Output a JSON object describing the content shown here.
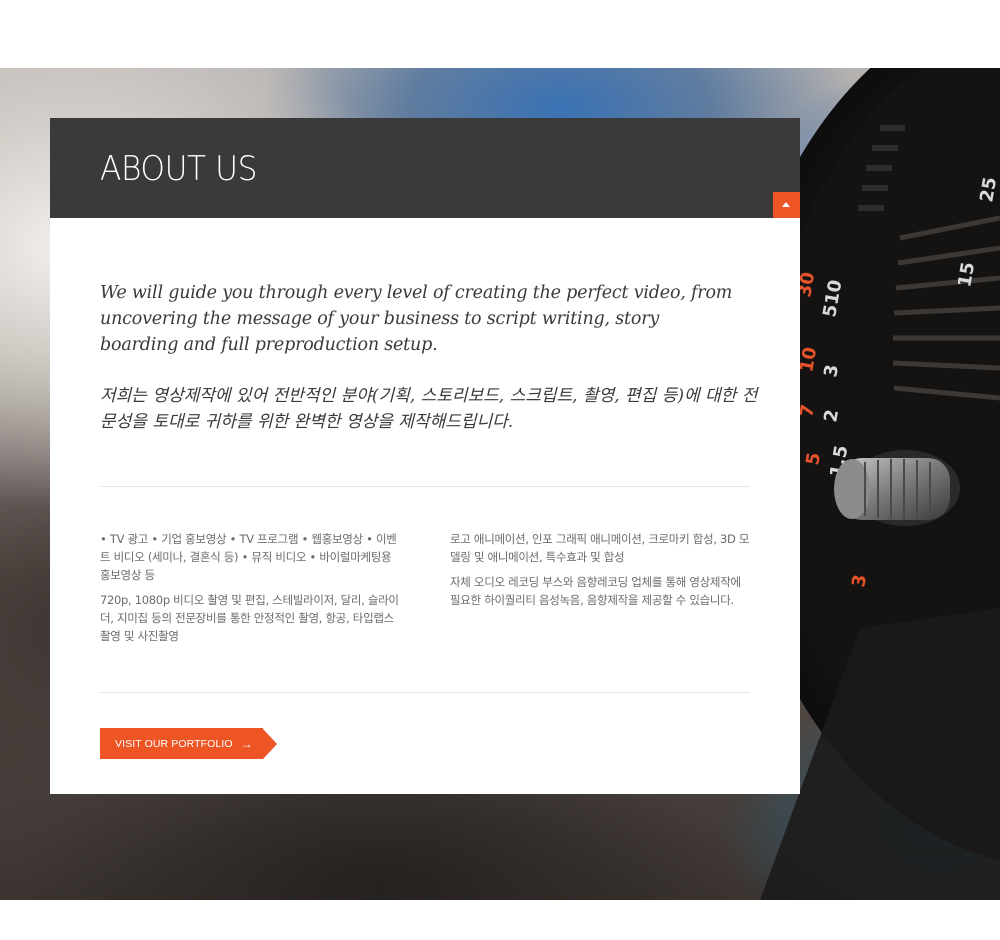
{
  "about": {
    "title": "ABOUT US",
    "intro_en": "We will guide you through every level of creating the perfect video, from uncovering the message of your business to script writing, story boarding and full preproduction setup.",
    "intro_ko": "저희는 영상제작에 있어 전반적인 분야(기획, 스토리보드, 스크립트, 촬영, 편집 등)에 대한 전문성을 토대로 귀하를 위한 완벽한 영상을 제작해드립니다.",
    "services_left": [
      "• TV 광고 • 기업 홍보영상 • TV 프로그램 • 웹홍보영상 • 이벤트 비디오 (세미나, 결혼식 등) • 뮤직 비디오 • 바이럴마케팅용 홍보영상 등",
      "720p, 1080p 비디오 촬영 및 편집, 스테빌라이저, 달리, 슬라이더, 지미집 등의 전문장비를 통한 안정적인 촬영, 항공, 타입랩스 촬영 및 사진촬영"
    ],
    "services_right": [
      "로고 애니메이션, 인포 그래픽 애니메이션, 크로마키 합성, 3D 모델링 및 애니메이션, 특수효과 및 합성",
      "자체 오디오 레코딩 부스와 음향레코딩 업체를 통해 영상제작에 필요한 하이퀄리티 음성녹음, 음향제작을 제공할 수 있습니다."
    ],
    "cta_label": "VISIT OUR PORTFOLIO",
    "cta_icon": "arrow-right-icon",
    "collapse_icon": "caret-up-icon"
  },
  "colors": {
    "accent": "#ee5524",
    "header_bg": "#3a3a3a",
    "text": "#3a3a3a",
    "muted_text": "#6b6b6b"
  }
}
